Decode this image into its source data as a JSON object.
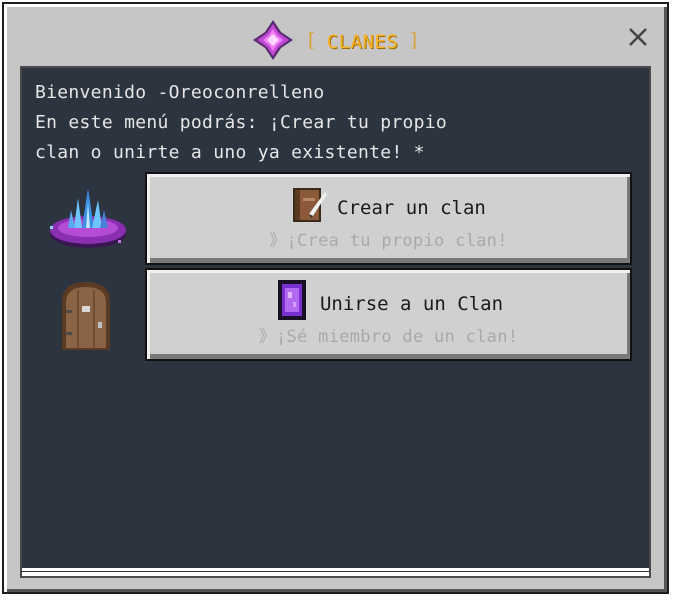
{
  "window": {
    "title": "CLANES",
    "title_bracket_open": "[",
    "title_bracket_close": "]",
    "title_icon": "amethyst-gem-icon",
    "close_label": "×"
  },
  "welcome": {
    "line1": "Bienvenido -Oreoconrelleno",
    "line2": "En este menú podrás: ¡Crear tu propio",
    "line3": "clan o unirte a uno ya existente! *"
  },
  "side_images": [
    "purple-crystal-island-icon",
    "wooden-door-icon"
  ],
  "options": [
    {
      "label": "Crear un clan",
      "subtitle": "》¡Crea tu propio clan!",
      "icon": "book-and-quill-icon"
    },
    {
      "label": "Unirse a un Clan",
      "subtitle": "》¡Sé miembro de un clan!",
      "icon": "nether-portal-icon"
    }
  ],
  "colors": {
    "frame": "#c6c6c6",
    "panel": "#2c3440",
    "title": "#f5b225",
    "button": "#d0d0d0",
    "subtitle": "#a9a9a9"
  }
}
